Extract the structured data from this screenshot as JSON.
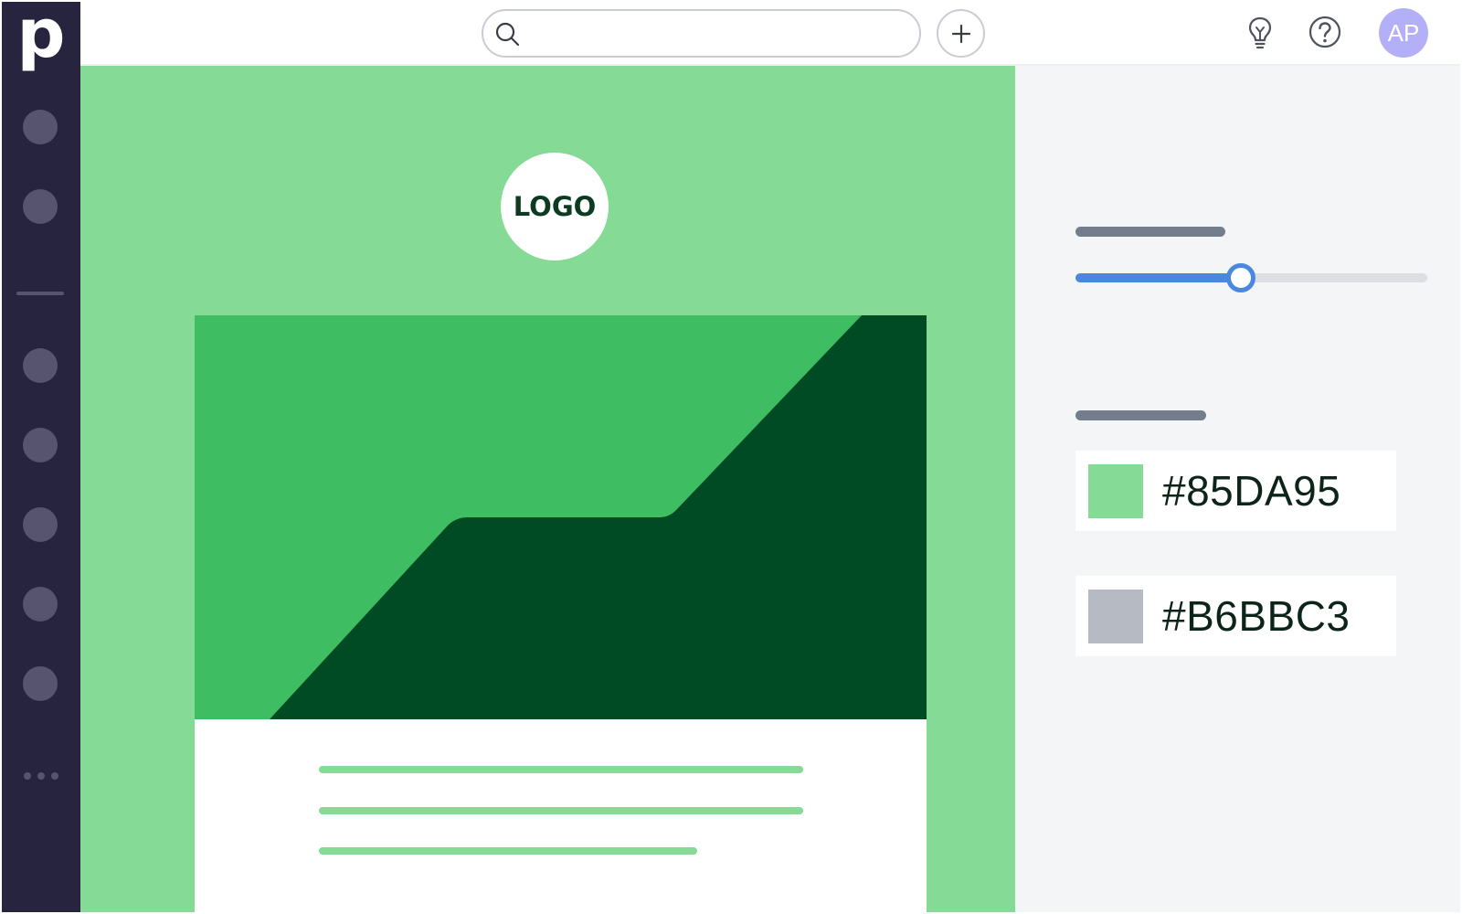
{
  "brand": {
    "letter": "p"
  },
  "topbar": {
    "search": {
      "value": "",
      "placeholder": ""
    },
    "icons": [
      "search-icon",
      "plus-icon",
      "lightbulb-icon",
      "help-icon"
    ],
    "avatar_initials": "AP"
  },
  "sidebar": {
    "nav_items": 7,
    "more_icon": "ellipsis-icon"
  },
  "canvas": {
    "logo_text": "LOGO",
    "colors": {
      "background": "#85DA95",
      "hero_light": "#3FBD63",
      "hero_dark": "#004A24"
    }
  },
  "panel": {
    "slider": {
      "value_fraction": 0.47
    },
    "colors": [
      {
        "hex": "#85DA95",
        "swatch": "#85DA95"
      },
      {
        "hex": "#B6BBC3",
        "swatch": "#B6BBC3"
      }
    ],
    "accent": "#4A88E0"
  }
}
